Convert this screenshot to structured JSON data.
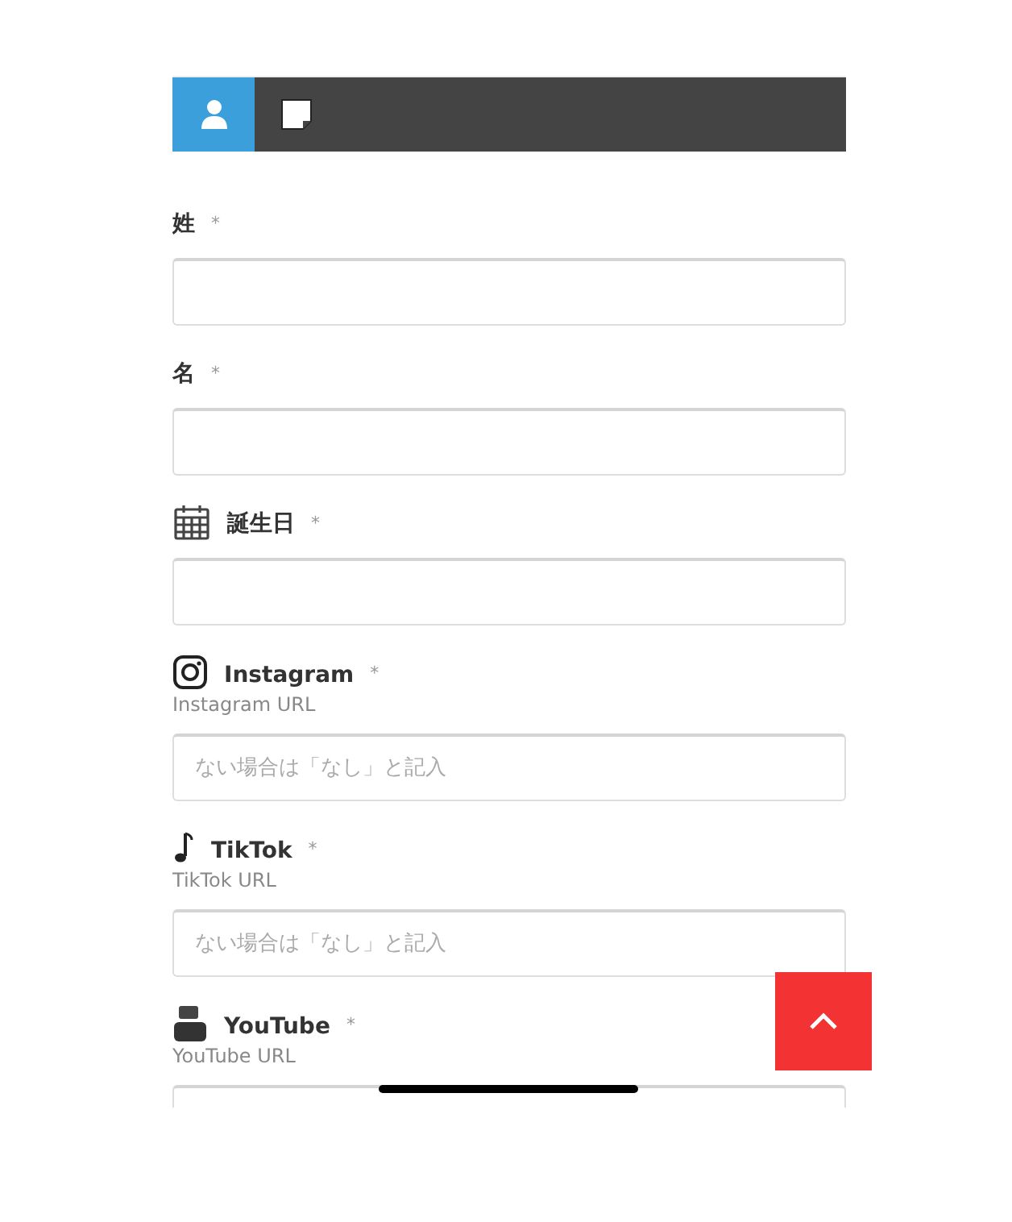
{
  "tabs": [
    {
      "selected": true
    },
    {
      "selected": false
    }
  ],
  "fields": [
    {
      "label": "姓",
      "mark": "*"
    },
    {
      "label": "名",
      "mark": "*"
    },
    {
      "label": "誕生日",
      "mark": "*"
    },
    {
      "label": "Instagram",
      "mark": "*",
      "hint": "Instagram URL",
      "placeholder": "ない場合は「なし」と記入"
    },
    {
      "label": "TikTok",
      "mark": "*",
      "hint": "TikTok URL",
      "placeholder": "ない場合は「なし」と記入"
    },
    {
      "label": "YouTube",
      "mark": "*",
      "hint": "YouTube URL"
    }
  ]
}
